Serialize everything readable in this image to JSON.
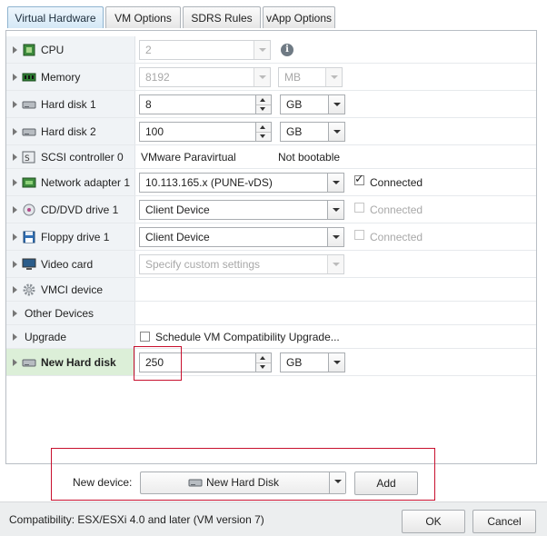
{
  "tabs": [
    {
      "label": "Virtual Hardware",
      "active": true
    },
    {
      "label": "VM Options"
    },
    {
      "label": "SDRS Rules"
    },
    {
      "label": "vApp Options"
    }
  ],
  "rows": {
    "cpu": {
      "label": "CPU",
      "value": "2"
    },
    "memory": {
      "label": "Memory",
      "value": "8192",
      "unit": "MB"
    },
    "hd1": {
      "label": "Hard disk 1",
      "value": "8",
      "unit": "GB"
    },
    "hd2": {
      "label": "Hard disk 2",
      "value": "100",
      "unit": "GB"
    },
    "scsi": {
      "label": "SCSI controller 0",
      "type": "VMware Paravirtual",
      "boot": "Not bootable"
    },
    "net": {
      "label": "Network adapter 1",
      "value": "10.113.165.x (PUNE-vDS)",
      "connected": "Connected"
    },
    "cd": {
      "label": "CD/DVD drive 1",
      "value": "Client Device",
      "connected": "Connected"
    },
    "floppy": {
      "label": "Floppy drive 1",
      "value": "Client Device",
      "connected": "Connected"
    },
    "video": {
      "label": "Video card",
      "value": "Specify custom settings"
    },
    "vmci": {
      "label": "VMCI device"
    },
    "other": {
      "label": "Other Devices"
    },
    "upgrade": {
      "label": "Upgrade",
      "checkbox": "Schedule VM Compatibility Upgrade..."
    },
    "newhd": {
      "label": "New Hard disk",
      "value": "250",
      "unit": "GB"
    }
  },
  "new_device": {
    "label": "New device:",
    "value": "New Hard Disk",
    "add": "Add"
  },
  "footer": {
    "compat": "Compatibility: ESX/ESXi 4.0 and later (VM version 7)",
    "ok": "OK",
    "cancel": "Cancel"
  },
  "icons": {
    "info": "i"
  }
}
